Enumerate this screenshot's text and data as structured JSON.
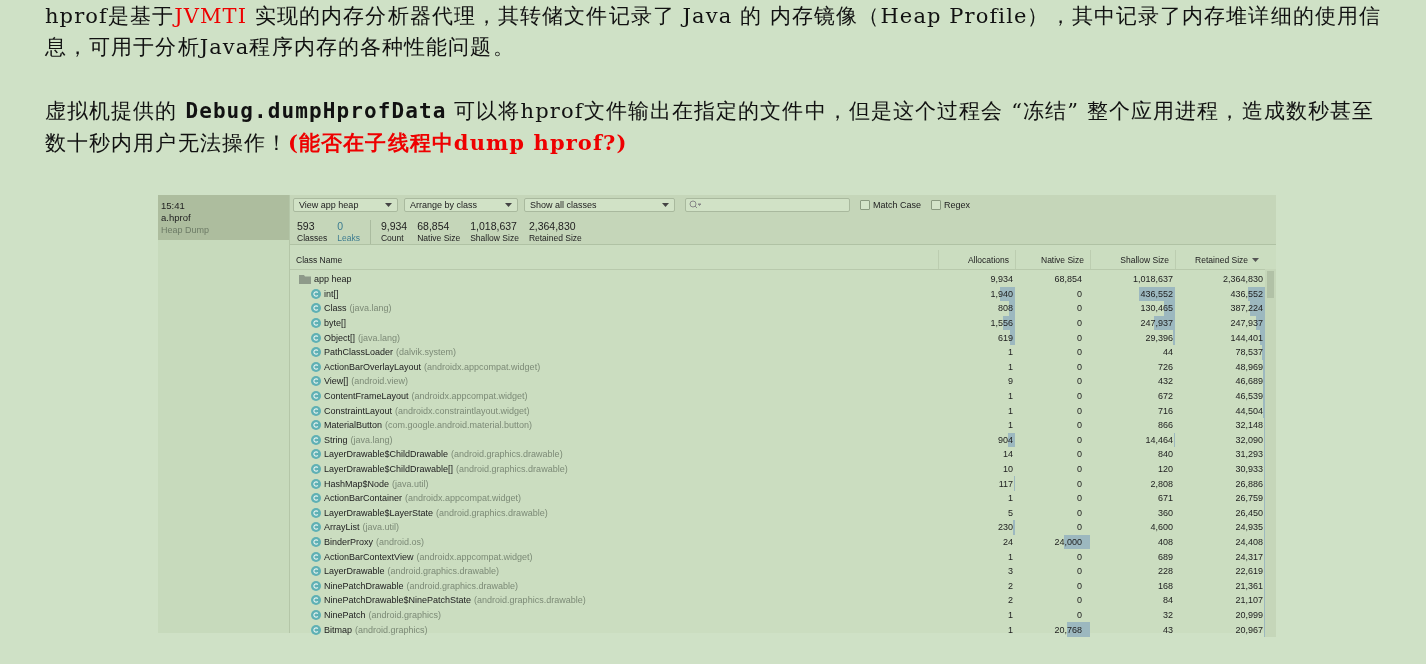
{
  "paragraphs": [
    [
      {
        "kind": "text",
        "text": "hprof是基于"
      },
      {
        "kind": "red",
        "text": "JVMTI"
      },
      {
        "kind": "text",
        "text": " 实现的内存分析器代理，其转储文件记录了 Java 的 内存镜像（Heap Profile），其中记录了内存堆详细的使用信息，可用于分析Java程序内存的各种性能问题。"
      }
    ],
    [
      {
        "kind": "text",
        "text": "虚拟机提供的 "
      },
      {
        "kind": "code",
        "text": "Debug.dumpHprofData"
      },
      {
        "kind": "text",
        "text": " 可以将hprof文件输出在指定的文件中，但是这个过程会 “冻结” 整个应用进程，造成数秒甚至数十秒内用户无法操作！"
      },
      {
        "kind": "redbold",
        "text": "(能否在子线程中dump hprof?)"
      }
    ]
  ],
  "sidebar": {
    "items": [
      {
        "time": "15:41",
        "file": "a.hprof",
        "type": "Heap Dump",
        "selected": true
      }
    ]
  },
  "toolbar": {
    "dropdowns": [
      "View app heap",
      "Arrange by class",
      "Show all classes"
    ],
    "checkboxes": [
      {
        "label": "Match Case",
        "checked": false
      },
      {
        "label": "Regex",
        "checked": false
      }
    ]
  },
  "summary": [
    {
      "value": "593",
      "label": "Classes",
      "kind": "plain"
    },
    {
      "value": "0",
      "label": "Leaks",
      "kind": "link"
    },
    {
      "value": "9,934",
      "label": "Count",
      "kind": "plain"
    },
    {
      "value": "68,854",
      "label": "Native Size",
      "kind": "plain"
    },
    {
      "value": "1,018,637",
      "label": "Shallow Size",
      "kind": "plain"
    },
    {
      "value": "2,364,830",
      "label": "Retained Size",
      "kind": "plain"
    }
  ],
  "table": {
    "columns": [
      {
        "label": "Class Name",
        "sorted": false
      },
      {
        "label": "Allocations",
        "sorted": false
      },
      {
        "label": "Native Size",
        "sorted": false
      },
      {
        "label": "Shallow Size",
        "sorted": false
      },
      {
        "label": "Retained Size",
        "sorted": true
      }
    ],
    "rows": [
      {
        "kind": "folder",
        "name": "app heap",
        "allocations": "9,934",
        "native_size": "68,854",
        "shallow_size": "1,018,637",
        "retained_size": "2,364,830",
        "children": [
          {
            "kind": "class",
            "name": "int[]",
            "allocations": "1,940",
            "native_size": "0",
            "shallow_size": "436,552",
            "retained_size": "436,552"
          },
          {
            "kind": "class",
            "name": "Class",
            "package": "(java.lang)",
            "allocations": "808",
            "native_size": "0",
            "shallow_size": "130,465",
            "retained_size": "387,224"
          },
          {
            "kind": "class",
            "name": "byte[]",
            "allocations": "1,556",
            "native_size": "0",
            "shallow_size": "247,937",
            "retained_size": "247,937"
          },
          {
            "kind": "class",
            "name": "Object[]",
            "package": "(java.lang)",
            "allocations": "619",
            "native_size": "0",
            "shallow_size": "29,396",
            "retained_size": "144,401"
          },
          {
            "kind": "class",
            "name": "PathClassLoader",
            "package": "(dalvik.system)",
            "allocations": "1",
            "native_size": "0",
            "shallow_size": "44",
            "retained_size": "78,537"
          },
          {
            "kind": "class",
            "name": "ActionBarOverlayLayout",
            "package": "(androidx.appcompat.widget)",
            "allocations": "1",
            "native_size": "0",
            "shallow_size": "726",
            "retained_size": "48,969"
          },
          {
            "kind": "class",
            "name": "View[]",
            "package": "(android.view)",
            "allocations": "9",
            "native_size": "0",
            "shallow_size": "432",
            "retained_size": "46,689"
          },
          {
            "kind": "class",
            "name": "ContentFrameLayout",
            "package": "(androidx.appcompat.widget)",
            "allocations": "1",
            "native_size": "0",
            "shallow_size": "672",
            "retained_size": "46,539"
          },
          {
            "kind": "class",
            "name": "ConstraintLayout",
            "package": "(androidx.constraintlayout.widget)",
            "allocations": "1",
            "native_size": "0",
            "shallow_size": "716",
            "retained_size": "44,504"
          },
          {
            "kind": "class",
            "name": "MaterialButton",
            "package": "(com.google.android.material.button)",
            "allocations": "1",
            "native_size": "0",
            "shallow_size": "866",
            "retained_size": "32,148"
          },
          {
            "kind": "class",
            "name": "String",
            "package": "(java.lang)",
            "allocations": "904",
            "native_size": "0",
            "shallow_size": "14,464",
            "retained_size": "32,090"
          },
          {
            "kind": "class",
            "name": "LayerDrawable$ChildDrawable",
            "package": "(android.graphics.drawable)",
            "allocations": "14",
            "native_size": "0",
            "shallow_size": "840",
            "retained_size": "31,293"
          },
          {
            "kind": "class",
            "name": "LayerDrawable$ChildDrawable[]",
            "package": "(android.graphics.drawable)",
            "allocations": "10",
            "native_size": "0",
            "shallow_size": "120",
            "retained_size": "30,933"
          },
          {
            "kind": "class",
            "name": "HashMap$Node",
            "package": "(java.util)",
            "allocations": "117",
            "native_size": "0",
            "shallow_size": "2,808",
            "retained_size": "26,886"
          },
          {
            "kind": "class",
            "name": "ActionBarContainer",
            "package": "(androidx.appcompat.widget)",
            "allocations": "1",
            "native_size": "0",
            "shallow_size": "671",
            "retained_size": "26,759"
          },
          {
            "kind": "class",
            "name": "LayerDrawable$LayerState",
            "package": "(android.graphics.drawable)",
            "allocations": "5",
            "native_size": "0",
            "shallow_size": "360",
            "retained_size": "26,450"
          },
          {
            "kind": "class",
            "name": "ArrayList",
            "package": "(java.util)",
            "allocations": "230",
            "native_size": "0",
            "shallow_size": "4,600",
            "retained_size": "24,935"
          },
          {
            "kind": "class",
            "name": "BinderProxy",
            "package": "(android.os)",
            "allocations": "24",
            "native_size": "24,000",
            "shallow_size": "408",
            "retained_size": "24,408"
          },
          {
            "kind": "class",
            "name": "ActionBarContextView",
            "package": "(androidx.appcompat.widget)",
            "allocations": "1",
            "native_size": "0",
            "shallow_size": "689",
            "retained_size": "24,317"
          },
          {
            "kind": "class",
            "name": "LayerDrawable",
            "package": "(android.graphics.drawable)",
            "allocations": "3",
            "native_size": "0",
            "shallow_size": "228",
            "retained_size": "22,619"
          },
          {
            "kind": "class",
            "name": "NinePatchDrawable",
            "package": "(android.graphics.drawable)",
            "allocations": "2",
            "native_size": "0",
            "shallow_size": "168",
            "retained_size": "21,361"
          },
          {
            "kind": "class",
            "name": "NinePatchDrawable$NinePatchState",
            "package": "(android.graphics.drawable)",
            "allocations": "2",
            "native_size": "0",
            "shallow_size": "84",
            "retained_size": "21,107"
          },
          {
            "kind": "class",
            "name": "NinePatch",
            "package": "(android.graphics)",
            "allocations": "1",
            "native_size": "0",
            "shallow_size": "32",
            "retained_size": "20,999"
          },
          {
            "kind": "class",
            "name": "Bitmap",
            "package": "(android.graphics)",
            "allocations": "1",
            "native_size": "20,768",
            "shallow_size": "43",
            "retained_size": "20,967"
          }
        ]
      }
    ]
  }
}
